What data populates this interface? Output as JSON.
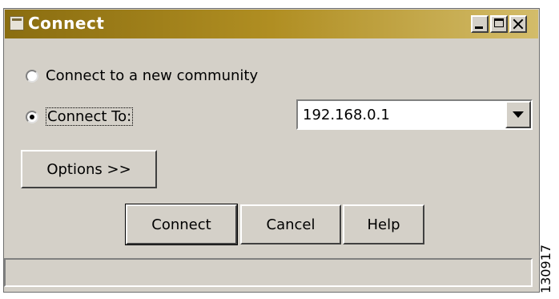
{
  "window": {
    "title": "Connect",
    "icon": "window-icon",
    "controls": [
      "minimize-icon",
      "maximize-icon",
      "close-icon"
    ]
  },
  "options": {
    "new_community_label": "Connect to a new community",
    "connect_to_label": "Connect To:",
    "selected": "connect_to"
  },
  "address": {
    "value": "192.168.0.1"
  },
  "buttons": {
    "options_label": "Options >>",
    "connect_label": "Connect",
    "cancel_label": "Cancel",
    "help_label": "Help"
  },
  "status": {
    "text": ""
  },
  "figure_id": "130917",
  "colors": {
    "title_gradient_start": "#8a6d10",
    "title_gradient_end": "#d3bc6a",
    "face": "#d4d0c8"
  }
}
